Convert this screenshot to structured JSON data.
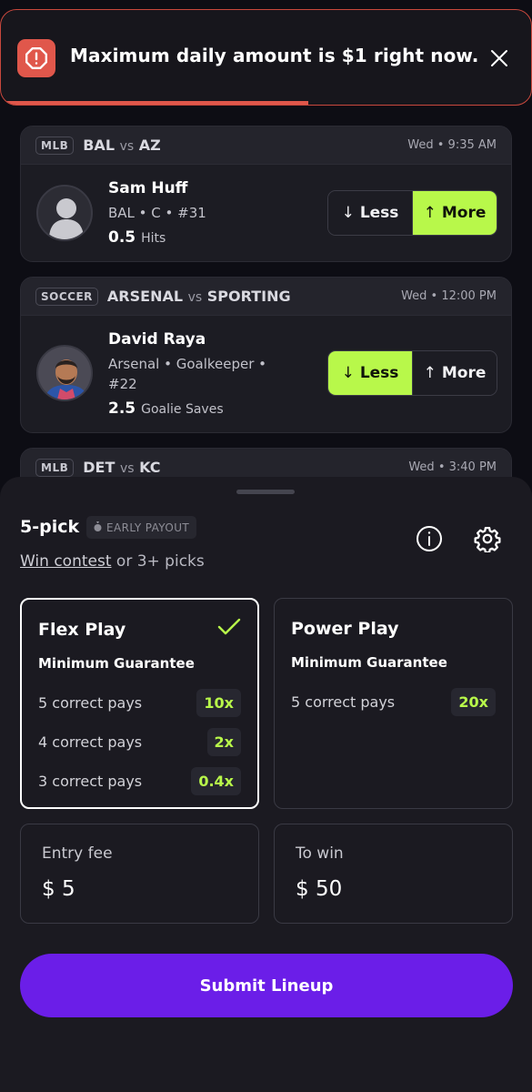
{
  "toast": {
    "message": "Maximum daily amount is $1 right now.",
    "icon": "alert-octagon-icon",
    "progress_fraction": 0.58,
    "accent": "#e0574b"
  },
  "cards": [
    {
      "league": "MLB",
      "team_a": "BAL",
      "vs": "vs",
      "team_b": "AZ",
      "time": "Wed • 9:35 AM",
      "player": "Sam Huff",
      "info": "BAL • C • #31",
      "line": "0.5",
      "stat": "Hits",
      "less_label": "Less",
      "more_label": "More",
      "selected": "more"
    },
    {
      "league": "SOCCER",
      "team_a": "ARSENAL",
      "vs": "vs",
      "team_b": "SPORTING",
      "time": "Wed • 12:00 PM",
      "player": "David Raya",
      "info": "Arsenal • Goalkeeper • #22",
      "line": "2.5",
      "stat": "Goalie Saves",
      "less_label": "Less",
      "more_label": "More",
      "selected": "less"
    },
    {
      "league": "MLB",
      "team_a": "DET",
      "vs": "vs",
      "team_b": "KC",
      "time": "Wed • 3:40 PM"
    }
  ],
  "sheet": {
    "pick_count": "5-pick",
    "early_payout": "EARLY PAYOUT",
    "win_contest": "Win contest",
    "win_rest": " or 3+ picks",
    "flex": {
      "title": "Flex Play",
      "subtitle": "Minimum Guarantee",
      "rows": [
        {
          "label": "5 correct pays",
          "mult": "10x"
        },
        {
          "label": "4 correct pays",
          "mult": "2x"
        },
        {
          "label": "3 correct pays",
          "mult": "0.4x"
        }
      ]
    },
    "power": {
      "title": "Power Play",
      "subtitle": "Minimum Guarantee",
      "rows": [
        {
          "label": "5 correct pays",
          "mult": "20x"
        }
      ]
    },
    "entry_fee_label": "Entry fee",
    "entry_fee_value": "$ 5",
    "to_win_label": "To win",
    "to_win_value": "$ 50",
    "submit_label": "Submit Lineup"
  },
  "colors": {
    "selected_green": "#b8f84a",
    "submit_purple": "#6b1ee8"
  }
}
